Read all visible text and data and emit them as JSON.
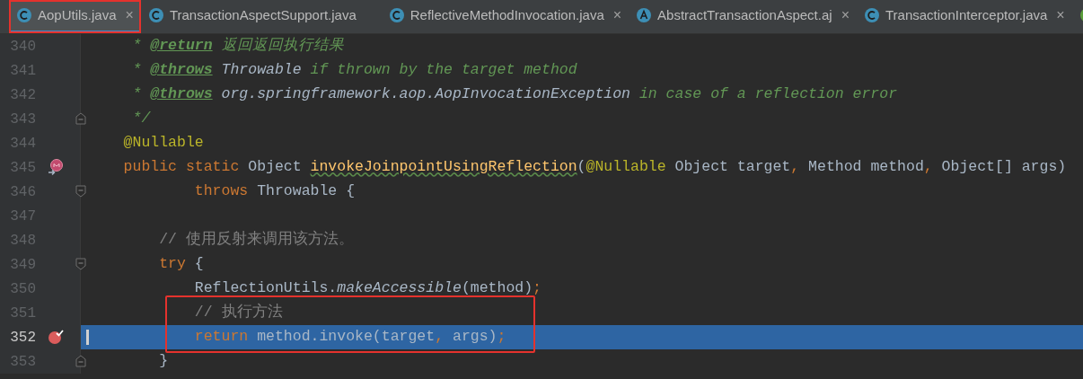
{
  "tabs": [
    {
      "label": "AopUtils.java",
      "kind": "class",
      "selected": true,
      "annotated": true,
      "close": "×"
    },
    {
      "label": "TransactionAspectSupport.java",
      "kind": "class",
      "selected": false,
      "annotated": false
    },
    {
      "label": "ReflectiveMethodInvocation.java",
      "kind": "class",
      "selected": false,
      "annotated": false,
      "close": "×"
    },
    {
      "label": "AbstractTransactionAspect.aj",
      "kind": "aspect",
      "selected": false,
      "annotated": false,
      "close": "×"
    },
    {
      "label": "TransactionInterceptor.java",
      "kind": "class",
      "selected": false,
      "annotated": false,
      "close": "×"
    },
    {
      "kind": "interface",
      "selected": false,
      "annotated": false
    }
  ],
  "lines": [
    {
      "number": "340",
      "current": false,
      "annotated": false,
      "segments": [
        {
          "kind": "doc",
          "text": "     * "
        },
        {
          "kind": "doctag",
          "text": "@return"
        },
        {
          "kind": "doc",
          "text": " 返回返回执行结果"
        }
      ]
    },
    {
      "number": "341",
      "current": false,
      "annotated": false,
      "segments": [
        {
          "kind": "doc",
          "text": "     * "
        },
        {
          "kind": "doctag",
          "text": "@throws"
        },
        {
          "kind": "docref",
          "text": " Throwable"
        },
        {
          "kind": "doc",
          "text": " if thrown by the target method"
        }
      ]
    },
    {
      "number": "342",
      "current": false,
      "annotated": false,
      "segments": [
        {
          "kind": "doc",
          "text": "     * "
        },
        {
          "kind": "doctag",
          "text": "@throws"
        },
        {
          "kind": "docref",
          "text": " org.springframework.aop.AopInvocationException"
        },
        {
          "kind": "doc",
          "text": " in case of a reflection error"
        }
      ]
    },
    {
      "number": "343",
      "current": false,
      "annotated": false,
      "kind": "fold_end",
      "segments": [
        {
          "kind": "doc",
          "text": "     */"
        }
      ]
    },
    {
      "number": "344",
      "current": false,
      "annotated": false,
      "segments": [
        {
          "kind": "annotation",
          "text": "    @Nullable"
        }
      ]
    },
    {
      "number": "345",
      "current": false,
      "annotated": false,
      "kind": "override",
      "segments": [
        {
          "kind": "keyword",
          "text": "    public static "
        },
        {
          "kind": "plain",
          "text": "Object "
        },
        {
          "kind": "method_flagged",
          "text": "invokeJoinpointUsingReflection"
        },
        {
          "kind": "plain",
          "text": "("
        },
        {
          "kind": "annotation",
          "text": "@Nullable"
        },
        {
          "kind": "plain",
          "text": " Object target"
        },
        {
          "kind": "keyword",
          "text": ","
        },
        {
          "kind": "plain",
          "text": " Method method"
        },
        {
          "kind": "keyword",
          "text": ","
        },
        {
          "kind": "plain",
          "text": " Object[] args)"
        }
      ]
    },
    {
      "number": "346",
      "current": false,
      "annotated": false,
      "kind": "fold_start",
      "segments": [
        {
          "kind": "keyword",
          "text": "            throws"
        },
        {
          "kind": "plain",
          "text": " Throwable {"
        }
      ]
    },
    {
      "number": "347",
      "current": false,
      "annotated": false
    },
    {
      "number": "348",
      "current": false,
      "annotated": false,
      "segments": [
        {
          "kind": "comment",
          "text": "        // 使用反射来调用该方法。"
        }
      ]
    },
    {
      "number": "349",
      "current": false,
      "annotated": false,
      "kind": "fold_start",
      "segments": [
        {
          "kind": "keyword",
          "text": "        try"
        },
        {
          "kind": "plain",
          "text": " {"
        }
      ]
    },
    {
      "number": "350",
      "current": false,
      "annotated": false,
      "segments": [
        {
          "kind": "plain",
          "text": "            ReflectionUtils."
        },
        {
          "kind": "static_call",
          "text": "makeAccessible"
        },
        {
          "kind": "plain",
          "text": "(method)"
        },
        {
          "kind": "keyword",
          "text": ";"
        }
      ]
    },
    {
      "number": "351",
      "current": false,
      "annotated": true,
      "segments": [
        {
          "kind": "comment",
          "text": "            // 执行方法"
        }
      ]
    },
    {
      "number": "352",
      "current": true,
      "annotated": true,
      "kind": "breakpoint",
      "segments": [
        {
          "kind": "keyword",
          "text": "            return"
        },
        {
          "kind": "plain",
          "text": " method.invoke(target"
        },
        {
          "kind": "keyword",
          "text": ","
        },
        {
          "kind": "plain",
          "text": " args)"
        },
        {
          "kind": "keyword",
          "text": ";"
        }
      ]
    },
    {
      "number": "353",
      "current": false,
      "annotated": false,
      "kind": "fold_end",
      "segments": [
        {
          "kind": "plain",
          "text": "        }"
        }
      ]
    }
  ]
}
